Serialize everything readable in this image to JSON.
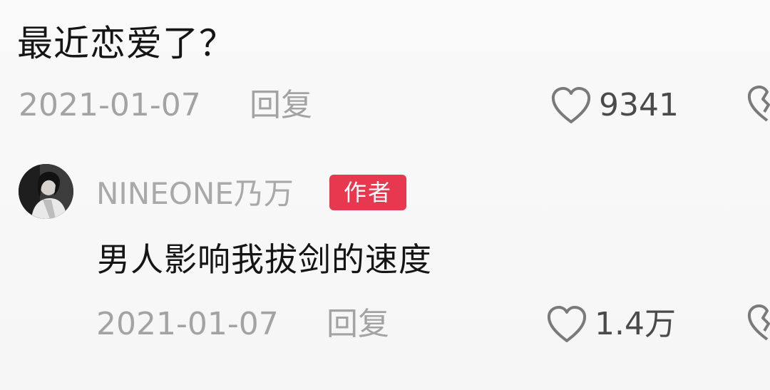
{
  "comment": {
    "text": "最近恋爱了？",
    "date": "2021-01-07",
    "reply_label": "回复",
    "like_count": "9341",
    "icons": [
      "heart-outline-icon",
      "broken-heart-icon"
    ]
  },
  "reply": {
    "username": "NINEONE乃万",
    "badge": "作者",
    "text": "男人影响我拔剑的速度",
    "date": "2021-01-07",
    "reply_label": "回复",
    "like_count": "1.4万",
    "icons": [
      "heart-outline-icon",
      "broken-heart-icon"
    ]
  },
  "colors": {
    "background": "#f7f7f7",
    "primary_text": "#151515",
    "secondary_text": "#a3a3a3",
    "badge": "#e8384f"
  }
}
